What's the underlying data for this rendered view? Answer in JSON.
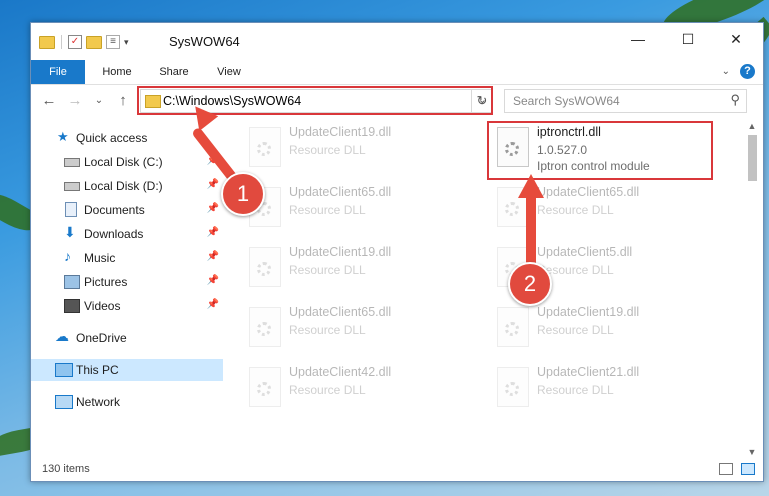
{
  "window": {
    "title": "SysWOW64"
  },
  "ribbon": {
    "tabs": [
      "File",
      "Home",
      "Share",
      "View"
    ]
  },
  "address": {
    "path": "C:\\Windows\\SysWOW64",
    "search_placeholder": "Search SysWOW64"
  },
  "sidebar": {
    "items": [
      {
        "label": "Quick access",
        "icon": "star-icon"
      },
      {
        "label": "Local Disk (C:)",
        "icon": "drive-icon"
      },
      {
        "label": "Local Disk (D:)",
        "icon": "drive-icon"
      },
      {
        "label": "Documents",
        "icon": "documents-icon"
      },
      {
        "label": "Downloads",
        "icon": "downloads-icon"
      },
      {
        "label": "Music",
        "icon": "music-icon"
      },
      {
        "label": "Pictures",
        "icon": "pictures-icon"
      },
      {
        "label": "Videos",
        "icon": "videos-icon"
      },
      {
        "label": "OneDrive",
        "icon": "cloud-icon"
      },
      {
        "label": "This PC",
        "icon": "computer-icon"
      },
      {
        "label": "Network",
        "icon": "network-icon"
      }
    ]
  },
  "files": [
    {
      "name": "UpdateClient19.dll",
      "line2": "Resource DLL",
      "line3": ""
    },
    {
      "name": "iptronctrl.dll",
      "line2": "1.0.527.0",
      "line3": "Iptron control module"
    },
    {
      "name": "UpdateClient65.dll",
      "line2": "Resource DLL",
      "line3": ""
    },
    {
      "name": "UpdateClient65.dll",
      "line2": "Resource DLL",
      "line3": ""
    },
    {
      "name": "UpdateClient19.dll",
      "line2": "Resource DLL",
      "line3": ""
    },
    {
      "name": "UpdateClient5.dll",
      "line2": "Resource DLL",
      "line3": ""
    },
    {
      "name": "UpdateClient65.dll",
      "line2": "Resource DLL",
      "line3": ""
    },
    {
      "name": "UpdateClient19.dll",
      "line2": "Resource DLL",
      "line3": ""
    },
    {
      "name": "UpdateClient42.dll",
      "line2": "Resource DLL",
      "line3": ""
    },
    {
      "name": "UpdateClient21.dll",
      "line2": "Resource DLL",
      "line3": ""
    }
  ],
  "status": {
    "count": "130 items"
  },
  "annotations": {
    "step1": "1",
    "step2": "2"
  },
  "colors": {
    "accent": "#1979ca",
    "highlight": "#d9373a"
  }
}
